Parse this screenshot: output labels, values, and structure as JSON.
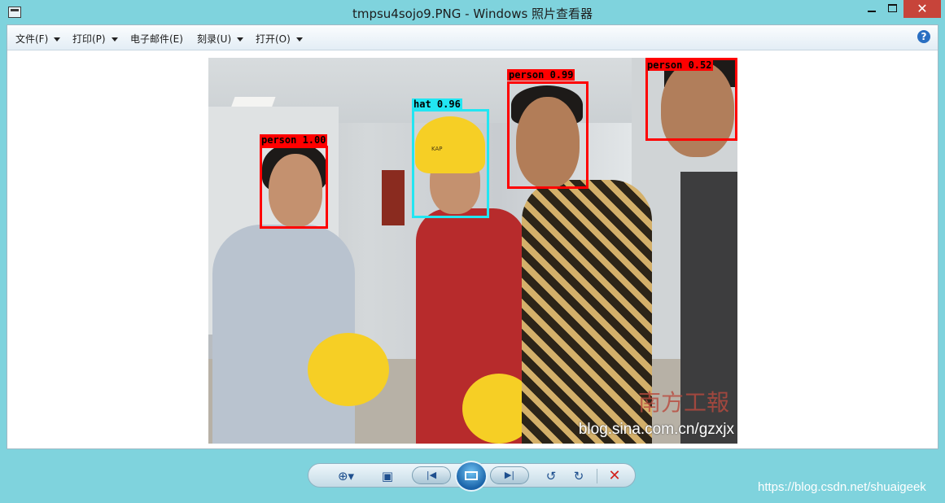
{
  "window": {
    "title": "tmpsu4sojo9.PNG - Windows 照片查看器",
    "min_symbol": "",
    "max_symbol": "",
    "close_symbol": "✕"
  },
  "menu": {
    "items": [
      {
        "label": "文件(F)",
        "has_dropdown": true
      },
      {
        "label": "打印(P)",
        "has_dropdown": true
      },
      {
        "label": "电子邮件(E)",
        "has_dropdown": false
      },
      {
        "label": "刻录(U)",
        "has_dropdown": true
      },
      {
        "label": "打开(O)",
        "has_dropdown": true
      }
    ],
    "help_label": "?"
  },
  "photo": {
    "detections": [
      {
        "label": "person 1.00",
        "class": "person"
      },
      {
        "label": "hat 0.96",
        "class": "hat"
      },
      {
        "label": "person 0.99",
        "class": "person"
      },
      {
        "label": "person 0.52",
        "class": "person"
      }
    ],
    "watermark": "blog.sina.com.cn/gzxjx",
    "stamp_text": "南方工報",
    "helmet_text": "KAP"
  },
  "toolbar": {
    "zoom_icon": "⊕▾",
    "fit_icon": "▣",
    "prev_icon": "|◀",
    "next_icon": "▶|",
    "rotate_left_icon": "↺",
    "rotate_right_icon": "↻",
    "delete_icon": "✕"
  },
  "overlay_watermark": "https://blog.csdn.net/shuaigeek",
  "colors": {
    "frame": "#7fd3dd",
    "person_box": "#ff0000",
    "hat_box": "#22e6f2",
    "delete": "#d2221c"
  }
}
